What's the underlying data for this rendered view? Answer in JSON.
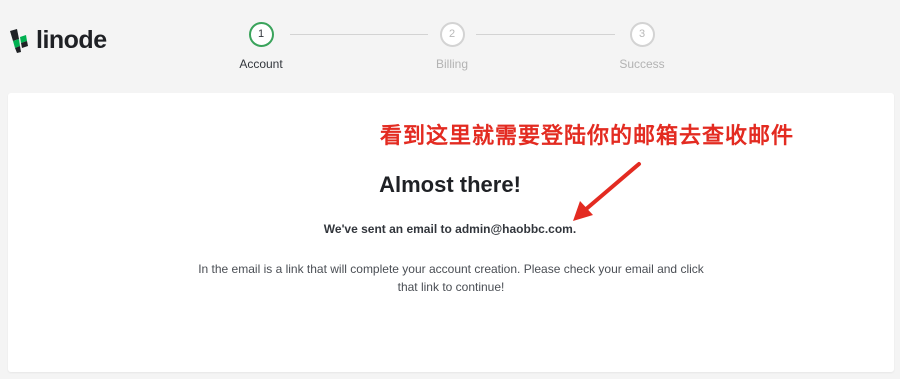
{
  "brand": {
    "name": "linode",
    "color": "#00b050"
  },
  "stepper": {
    "steps": [
      {
        "number": "1",
        "label": "Account",
        "active": true
      },
      {
        "number": "2",
        "label": "Billing",
        "active": false
      },
      {
        "number": "3",
        "label": "Success",
        "active": false
      }
    ],
    "active_color": "#3aa35b"
  },
  "annotation": {
    "text": "看到这里就需要登陆你的邮箱去查收邮件",
    "color": "#e32b21",
    "arrow_icon": "red-arrow-icon"
  },
  "main": {
    "title": "Almost there!",
    "sent_message": "We've sent an email to admin@haobbc.com.",
    "instructions": "In the email is a link that will complete your account creation. Please check your email and click that link to continue!"
  }
}
